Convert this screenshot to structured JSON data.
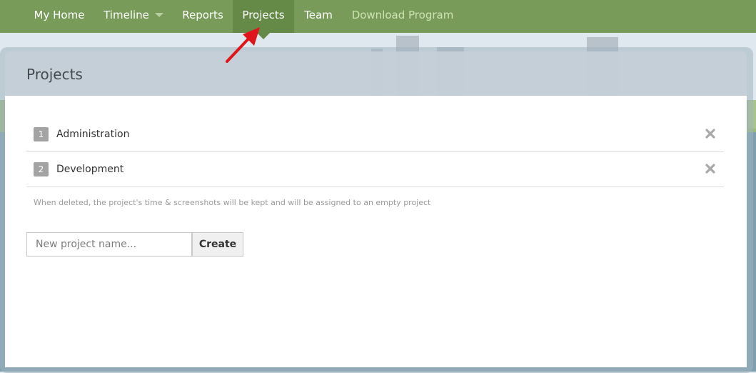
{
  "nav": {
    "items": [
      {
        "label": "My Home"
      },
      {
        "label": "Timeline",
        "has_dropdown": true
      },
      {
        "label": "Reports"
      },
      {
        "label": "Projects",
        "active": true
      },
      {
        "label": "Team"
      },
      {
        "label": "Download Program"
      }
    ]
  },
  "page": {
    "title": "Projects"
  },
  "projects": [
    {
      "number": "1",
      "name": "Administration"
    },
    {
      "number": "2",
      "name": "Development"
    }
  ],
  "hint": "When deleted, the project's time & screenshots will be kept and will be assigned to an empty project",
  "create_form": {
    "placeholder": "New project name...",
    "button_label": "Create"
  },
  "icons": {
    "delete": "close-icon",
    "timeline_dropdown": "caret-down-icon",
    "annotation": "red-arrow-icon"
  },
  "colors": {
    "navbar": "#789b5a",
    "navbar_active": "#658a48",
    "download_text": "#cfe3b4",
    "panel_header": "#c5cfd8",
    "annotation_arrow": "#e0141b"
  }
}
